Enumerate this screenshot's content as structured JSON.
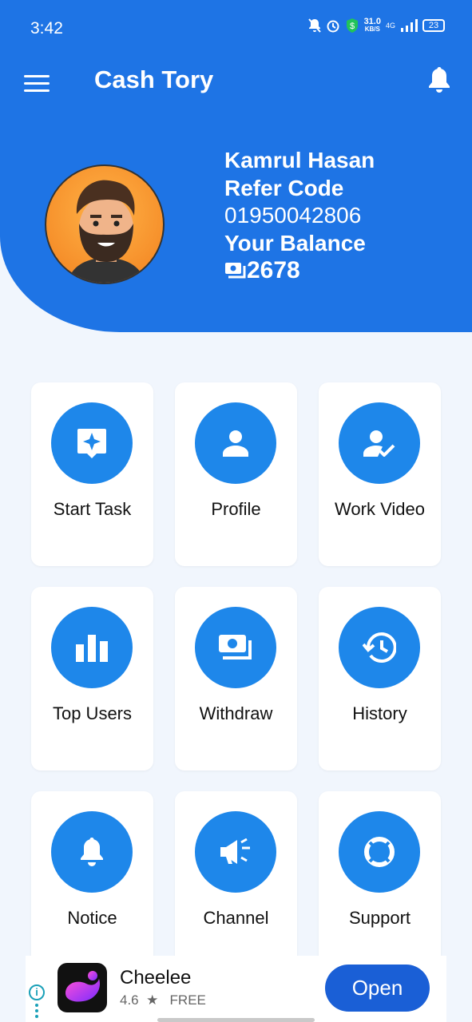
{
  "status_bar": {
    "time": "3:42",
    "net_speed": "31.0",
    "net_unit": "KB/S",
    "network": "4G",
    "battery": "23"
  },
  "appbar": {
    "title": "Cash Tory",
    "menu_icon": "hamburger-menu-icon",
    "bell_icon": "bell-icon"
  },
  "user": {
    "name": "Kamrul Hasan",
    "refer_label": "Refer Code",
    "refer_code": "01950042806",
    "balance_label": "Your Balance",
    "balance": "2678"
  },
  "menu": [
    {
      "label": "Start Task",
      "icon": "sparkle-chat-icon"
    },
    {
      "label": "Profile",
      "icon": "person-icon"
    },
    {
      "label": "Work Video",
      "icon": "person-check-icon"
    },
    {
      "label": "Top Users",
      "icon": "bar-chart-icon"
    },
    {
      "label": "Withdraw",
      "icon": "cash-icon"
    },
    {
      "label": "History",
      "icon": "history-icon"
    },
    {
      "label": "Notice",
      "icon": "bell-icon"
    },
    {
      "label": "Channel",
      "icon": "megaphone-icon"
    },
    {
      "label": "Support",
      "icon": "lifebuoy-icon"
    }
  ],
  "ad": {
    "app_name": "Cheelee",
    "rating": "4.6",
    "price": "FREE",
    "button": "Open"
  },
  "colors": {
    "primary": "#1e74e5",
    "icon_circle": "#1e87ea",
    "background": "#f1f6fd",
    "ad_button": "#1a5fd6"
  }
}
